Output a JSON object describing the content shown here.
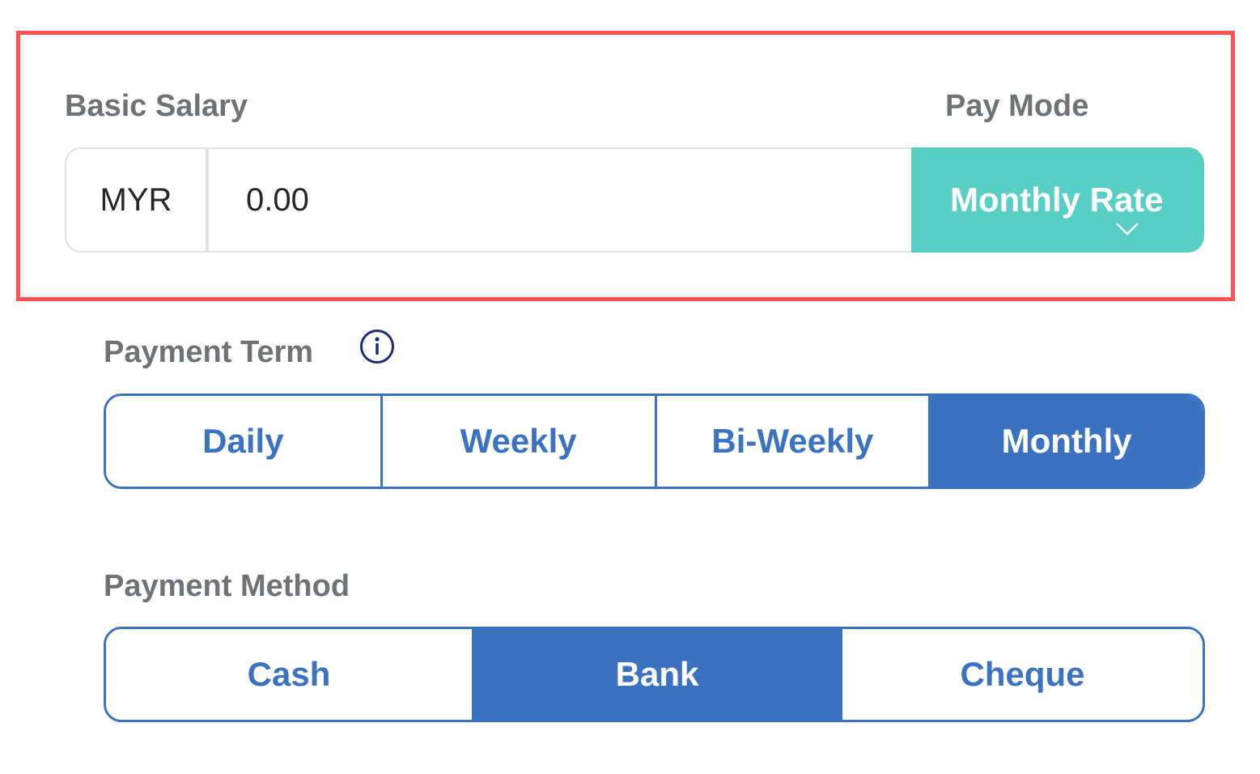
{
  "salary": {
    "label": "Basic Salary",
    "currency": "MYR",
    "value": "0.00"
  },
  "pay_mode": {
    "label": "Pay Mode",
    "selected": "Monthly Rate",
    "accent_color": "#57cfc5"
  },
  "payment_term": {
    "label": "Payment Term",
    "info_icon": "info-icon",
    "options": [
      "Daily",
      "Weekly",
      "Bi-Weekly",
      "Monthly"
    ],
    "selected": "Monthly"
  },
  "payment_method": {
    "label": "Payment Method",
    "options": [
      "Cash",
      "Bank",
      "Cheque"
    ],
    "selected": "Bank"
  },
  "colors": {
    "primary": "#3b72c2",
    "highlight_border": "#ff5252",
    "label_text": "#6f7378"
  }
}
